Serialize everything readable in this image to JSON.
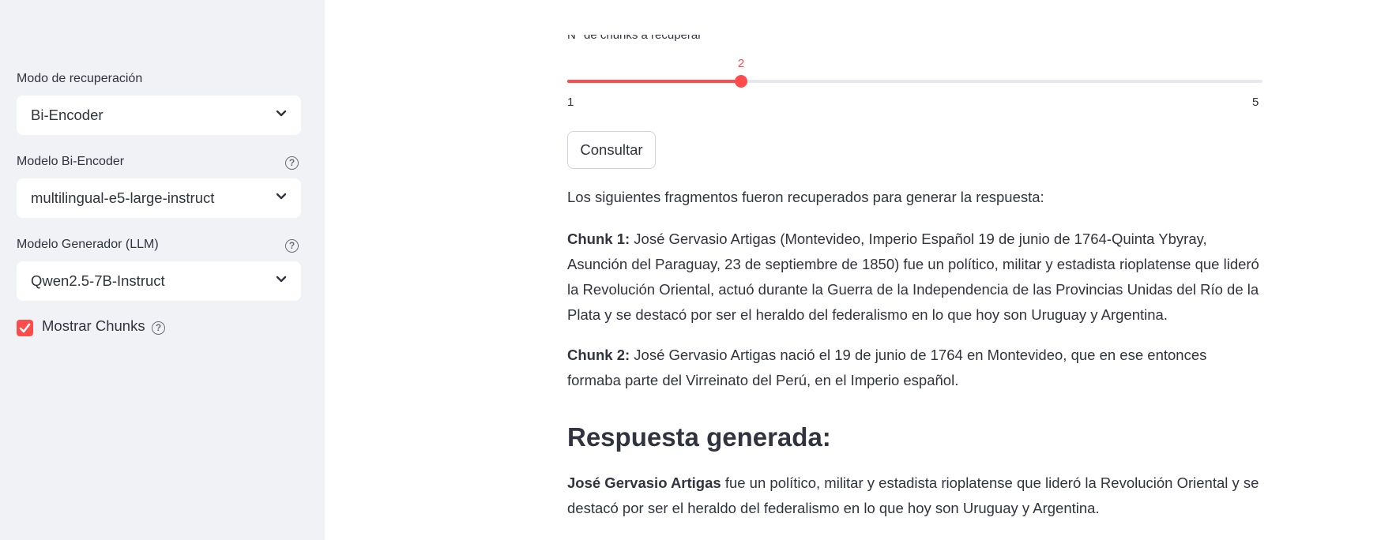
{
  "sidebar": {
    "retrieval_mode": {
      "label": "Modo de recuperación",
      "value": "Bi-Encoder"
    },
    "bi_encoder_model": {
      "label": "Modelo Bi-Encoder",
      "value": "multilingual-e5-large-instruct"
    },
    "generator_model": {
      "label": "Modelo Generador (LLM)",
      "value": "Qwen2.5-7B-Instruct"
    },
    "show_chunks": {
      "label": "Mostrar Chunks",
      "checked": true
    }
  },
  "main": {
    "slider": {
      "label": "N° de chunks a recuperar",
      "value": 2,
      "value_text": "2",
      "min": 1,
      "max": 5,
      "min_text": "1",
      "max_text": "5"
    },
    "query_button": "Consultar",
    "intro": "Los siguientes fragmentos fueron recuperados para generar la respuesta:",
    "chunks": [
      {
        "label": "Chunk 1:",
        "text": " José Gervasio Artigas (Montevideo, Imperio Español 19 de junio de 1764-Quinta Ybyray, Asunción del Paraguay, 23 de septiembre de 1850) fue un político, militar y estadista rioplatense que lideró la Revolución Oriental, actuó durante la Guerra de la Independencia de las Provincias Unidas del Río de la Plata y se destacó por ser el heraldo del federalismo en lo que hoy son Uruguay y Argentina."
      },
      {
        "label": "Chunk 2:",
        "text": " José Gervasio Artigas nació el 19 de junio de 1764 en Montevideo, que en ese entonces formaba parte del Virreinato del Perú, en el Imperio español."
      }
    ],
    "answer_heading": "Respuesta generada:",
    "answer": {
      "bold": "José Gervasio Artigas",
      "text": " fue un político, militar y estadista rioplatense que lideró la Revolución Oriental y se destacó por ser el heraldo del federalismo en lo que hoy son Uruguay y Argentina."
    }
  },
  "colors": {
    "accent": "#ff4b4b",
    "sidebar_bg": "#f0f2f6",
    "text": "#31333f"
  },
  "icons": [
    "chevron-down-icon",
    "help-icon",
    "checkmark-icon"
  ]
}
